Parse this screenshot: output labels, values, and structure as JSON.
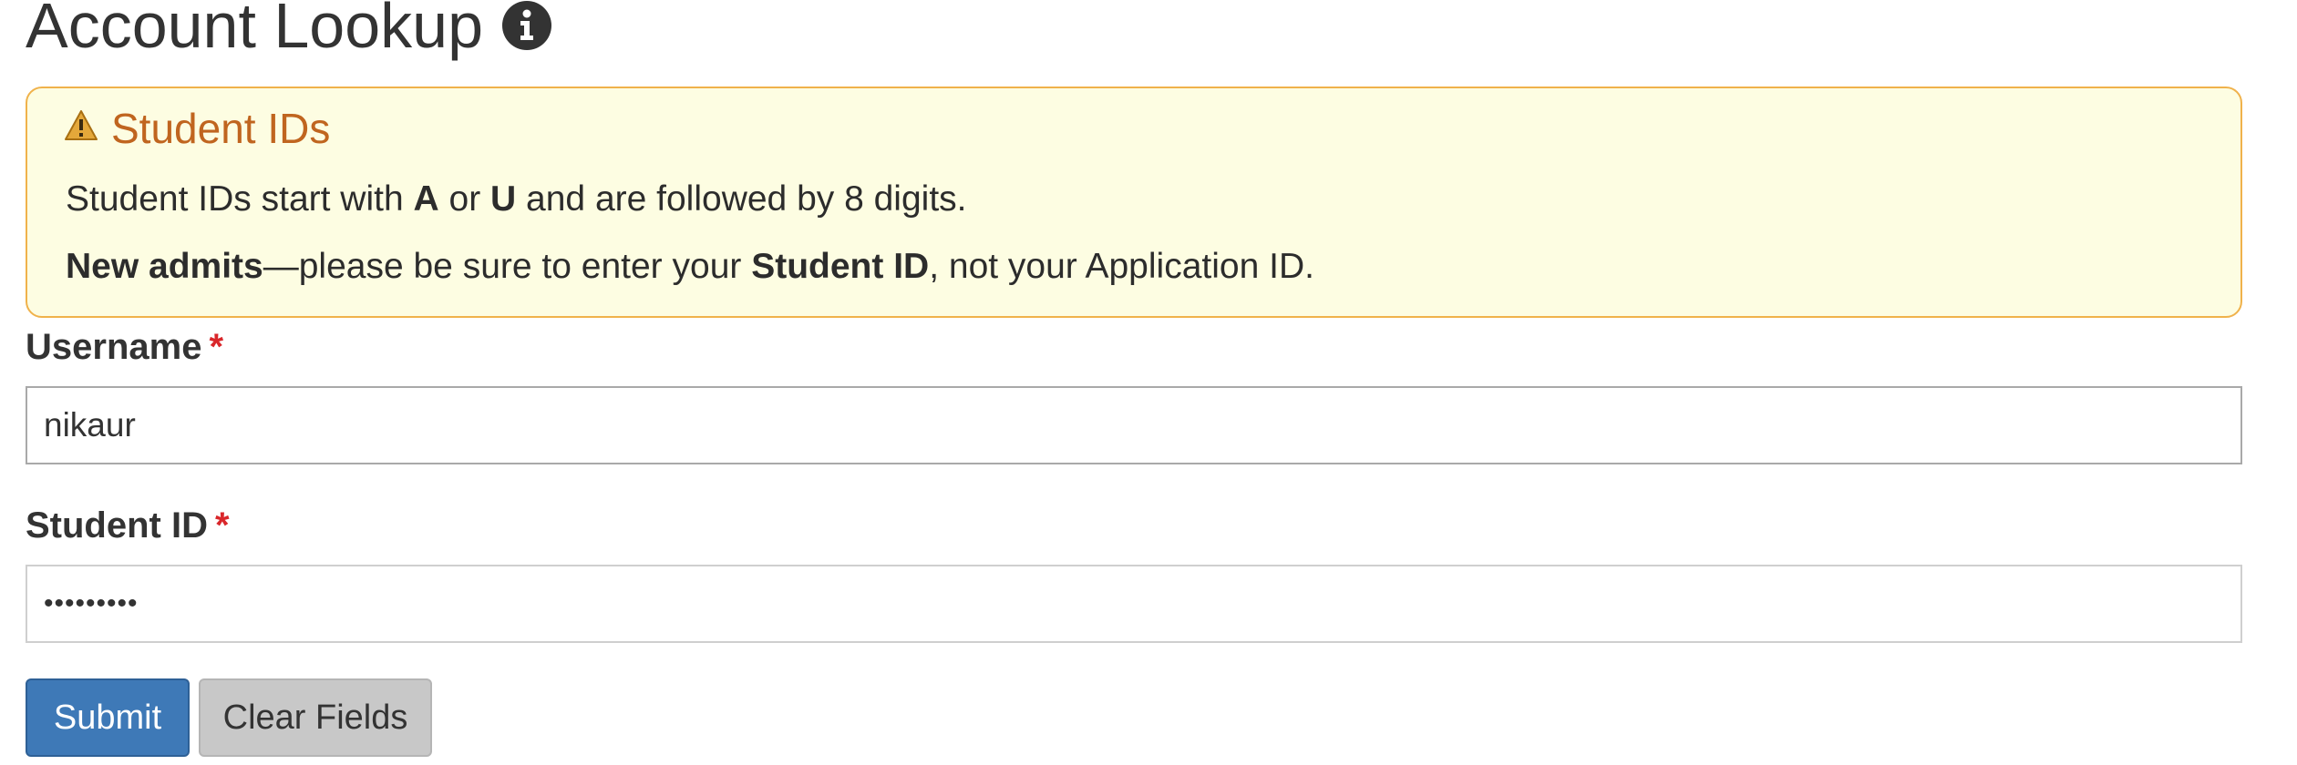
{
  "page": {
    "title": "Account Lookup",
    "title_icon": "info-circle-icon"
  },
  "alert": {
    "icon": "warning-triangle-icon",
    "title": "Student IDs",
    "line1": {
      "part1": "Student IDs start with ",
      "bold1": "A",
      "part2": " or ",
      "bold2": "U",
      "part3": " and are followed by 8 digits."
    },
    "line2": {
      "bold1": "New admits",
      "part1": "—please be sure to enter your ",
      "bold2": "Student ID",
      "part2": ", not your Application ID."
    },
    "colors": {
      "background": "#fdfde2",
      "border": "#f0b24b",
      "title": "#c0651f"
    }
  },
  "form": {
    "username": {
      "label": "Username",
      "required_mark": "*",
      "value": "nikaur"
    },
    "student_id": {
      "label": "Student ID",
      "required_mark": "*",
      "value": "•••••••••"
    },
    "buttons": {
      "submit_label": "Submit",
      "clear_label": "Clear Fields"
    },
    "colors": {
      "submit": "#3e79b7",
      "clear": "#c8c8c8",
      "required": "#d9262a"
    }
  }
}
